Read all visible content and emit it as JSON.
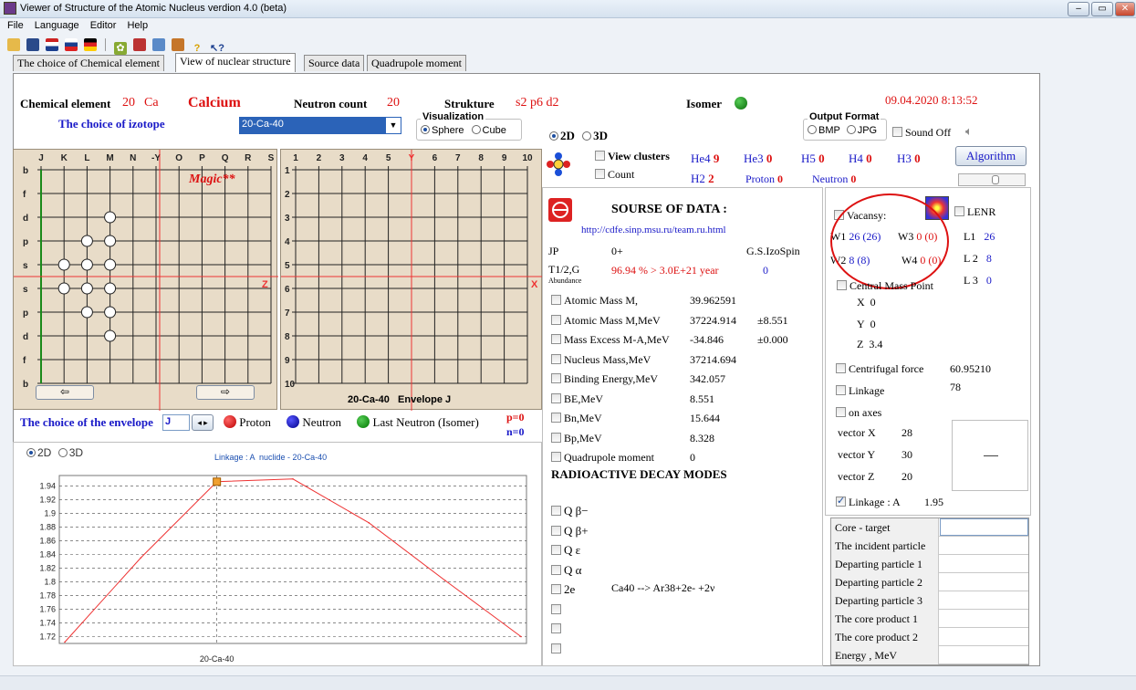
{
  "window": {
    "title": "Viewer of Structure of the Atomic Nucleus verdion 4.0 (beta)",
    "controls": [
      "–",
      "▭",
      "✕"
    ]
  },
  "menu": [
    "File",
    "Language",
    "Editor",
    "Help"
  ],
  "toolbar": {
    "icons": [
      "open-icon",
      "save-icon",
      "flag-uk-icon",
      "flag-ru-icon",
      "flag-de-icon",
      "atom-icon",
      "grid-icon",
      "chart-icon",
      "print-icon",
      "help-icon",
      "whatsthis-icon"
    ]
  },
  "tabs": [
    "The choice of Chemical element",
    "View of nuclear structure",
    "Source data",
    "Quadrupole moment"
  ],
  "header": {
    "chem_label": "Chemical element",
    "chem_z": "20",
    "chem_sym": "Ca",
    "chem_name": "Calcium",
    "neutron_label": "Neutron count",
    "neutron_value": "20",
    "struct_label": "Strukture",
    "struct_value": "s2 p6 d2",
    "isomer_label": "Isomer",
    "datetime": "09.04.2020  8:13:52",
    "isotope_label": "The choice of izotope",
    "isotope_value": "20-Ca-40",
    "visual_label": "Visualization",
    "sphere": "Sphere",
    "cube": "Cube",
    "mode2d": "2D",
    "mode3d": "3D",
    "output_label": "Output Format",
    "bmp": "BMP",
    "jpg": "JPG",
    "sound": "Sound Off"
  },
  "grid_left": {
    "cols": [
      "J",
      "K",
      "L",
      "M",
      "N",
      "-Y",
      "O",
      "P",
      "Q",
      "R",
      "S"
    ],
    "rows": [
      "b",
      "f",
      "d",
      "p",
      "s",
      "s",
      "p",
      "d",
      "f",
      "b"
    ],
    "magic": "Magic**",
    "axis_z": "Z"
  },
  "grid_right": {
    "cols": [
      "1",
      "2",
      "3",
      "4",
      "5",
      "Y",
      "6",
      "7",
      "8",
      "9",
      "10"
    ],
    "rows": [
      "1",
      "2",
      "3",
      "4",
      "5",
      "6",
      "7",
      "8",
      "9",
      "10"
    ],
    "axis_x": "X",
    "caption": "20-Ca-40   Envelope J"
  },
  "envelope": {
    "label": "The choice of the envelope",
    "value": "J",
    "proton": "Proton",
    "neutron": "Neutron",
    "last": "Last Neutron (Isomer)",
    "p": "p=0",
    "n": "n=0"
  },
  "clusters": {
    "view": "View clusters",
    "count": "Count",
    "he4": "He4",
    "he4v": "9",
    "he3": "He3",
    "he3v": "0",
    "h5": "H5",
    "h5v": "0",
    "h4": "H4",
    "h4v": "0",
    "h3": "H3",
    "h3v": "0",
    "h2": "H2",
    "h2v": "2",
    "proton": "Proton",
    "protonv": "0",
    "neutron": "Neutron",
    "neutronv": "0",
    "algorithm": "Algorithm"
  },
  "source": {
    "title": "SOURSE OF DATA :",
    "url": "http://cdfe.sinp.msu.ru/team.ru.html",
    "jp_label": "JP",
    "jp_value": "0+",
    "izospin": "G.S.IzoSpin",
    "t12": "T1/2,G",
    "abundance": "Abundance",
    "t12_value": "96.94 %  > 3.0E+21 year",
    "izo_value": "0",
    "props": [
      {
        "label": "Atomic Mass M,",
        "value": "39.962591",
        "err": ""
      },
      {
        "label": "Atomic Mass M,MeV",
        "value": "37224.914",
        "err": "±8.551"
      },
      {
        "label": "Mass Excess M-A,MeV",
        "value": "-34.846",
        "err": "±0.000"
      },
      {
        "label": "Nucleus Mass,MeV",
        "value": "37214.694",
        "err": ""
      },
      {
        "label": "Binding Energy,MeV",
        "value": "342.057",
        "err": ""
      },
      {
        "label": "BE,MeV",
        "value": "8.551",
        "err": ""
      },
      {
        "label": "Bn,MeV",
        "value": "15.644",
        "err": ""
      },
      {
        "label": "Bp,MeV",
        "value": "8.328",
        "err": ""
      },
      {
        "label": "Quadrupole moment",
        "value": "0",
        "err": ""
      }
    ],
    "decay_title": "RADIOACTIVE DECAY MODES",
    "decays": [
      "Q  β−",
      "Q  β+",
      "Q  ε",
      "Q  α",
      "2e",
      "",
      "",
      ""
    ],
    "decay_2e_text": "Ca40 --> Ar38+2e- +2ν"
  },
  "right": {
    "vacansy": "Vacansy:",
    "lenr": "LENR",
    "w1": "W1",
    "w1v": "26 (26)",
    "w3": "W3",
    "w3v": "0 (0)",
    "w2": "W2",
    "w2v": "8 (8)",
    "w4": "W4",
    "w4v": "0 (0)",
    "l1": "L1",
    "l1v": "26",
    "l2": "L 2",
    "l2v": "8",
    "l3": "L 3",
    "l3v": "0",
    "central": "Central Mass Point",
    "x": "X",
    "xv": "0",
    "y": "Y",
    "yv": "0",
    "z": "Z",
    "zv": "3.4",
    "centrifugal": "Centrifugal force",
    "centrifugal_v": "60.95210",
    "linkage": "Linkage",
    "linkage_v": "78",
    "onaxes": "on axes",
    "vx": "vector X",
    "vxv": "28",
    "vy": "vector Y",
    "vyv": "30",
    "vz": "vector Z",
    "vzv": "20",
    "linkA": "Linkage : A",
    "linkA_v": "1.95",
    "reaction_rows": [
      "Core - target",
      "The incident particle",
      "Departing particle 1",
      "Departing particle 2",
      "Departing particle 3",
      "The core product 1",
      "The core product 2",
      "Energy , MeV"
    ]
  },
  "chart_panel": {
    "mode2d": "2D",
    "mode3d": "3D"
  },
  "chart_data": {
    "type": "line",
    "title": "Linkage : A  nuclide - 20-Ca-40",
    "xlabel": "20-Ca-40",
    "ylabel": "",
    "ylim": [
      1.71,
      1.955
    ],
    "yticks": [
      1.72,
      1.74,
      1.76,
      1.78,
      1.8,
      1.82,
      1.84,
      1.86,
      1.88,
      1.9,
      1.92,
      1.94
    ],
    "x": [
      0,
      1,
      2,
      3,
      4,
      5,
      6
    ],
    "values": [
      1.712,
      1.835,
      1.946,
      1.95,
      1.886,
      1.802,
      1.72
    ],
    "marker_index": 2,
    "line_color": "#e33",
    "marker_color": "#f0a030"
  }
}
